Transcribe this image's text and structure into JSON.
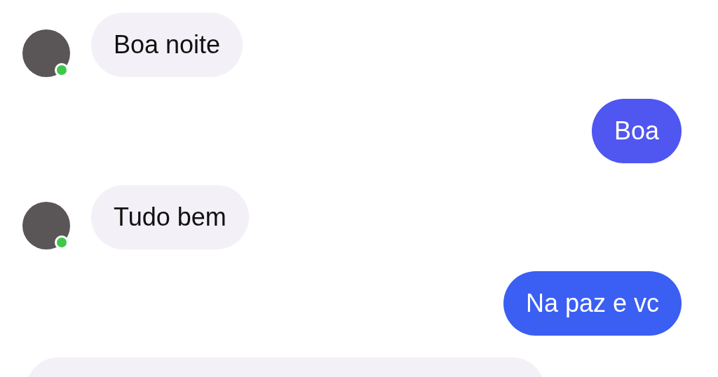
{
  "messages": [
    {
      "kind": "incoming",
      "text": "Boa noite",
      "online": true
    },
    {
      "kind": "outgoing",
      "text": "Boa",
      "color": "#5056f0"
    },
    {
      "kind": "incoming",
      "text": "Tudo bem",
      "online": true
    },
    {
      "kind": "outgoing",
      "text": "Na paz e vc",
      "color": "#3a5ff2"
    },
    {
      "kind": "partial"
    }
  ]
}
